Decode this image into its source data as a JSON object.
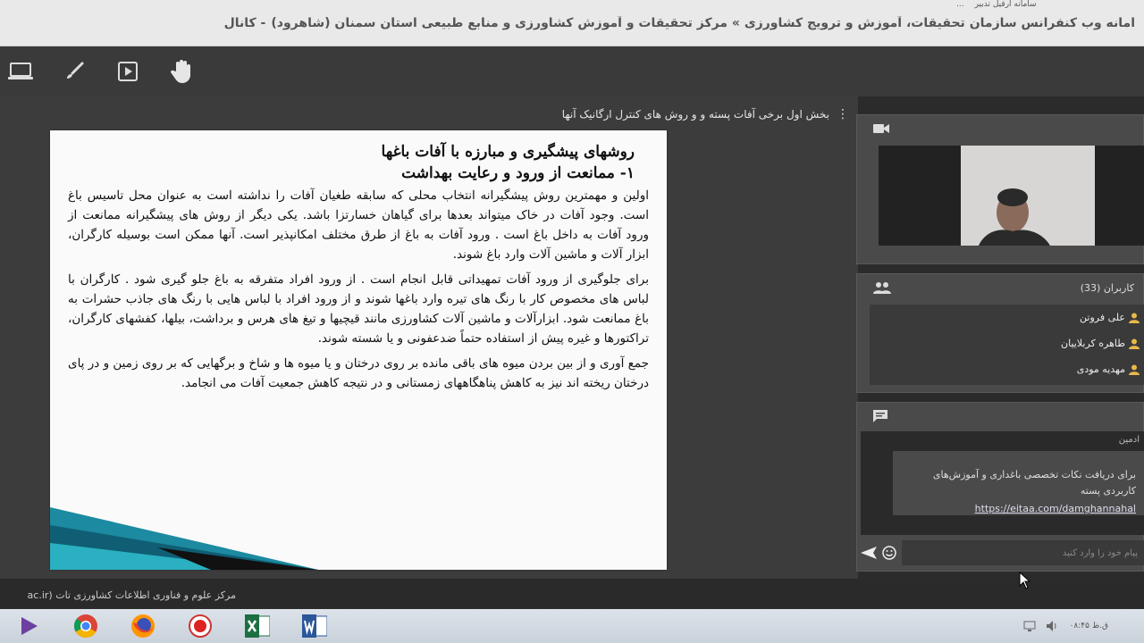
{
  "top_strip": {
    "user_name": "سامانه ارقیل تدبیر",
    "extra": "..."
  },
  "page_title": {
    "main": "امانه وب کنفرانس سازمان تحقیقات، آموزش و ترویج کشاورزی » مرکز تحقیقات و آموزش کشاورزی و منابع طبیعی استان سمنان (شاهرود)",
    "tail": "- کانال"
  },
  "toolbar": {
    "icons": [
      "screen-share-icon",
      "brush-icon",
      "play-media-icon",
      "hand-raise-icon"
    ]
  },
  "stage": {
    "title": "بخش اول برخی آفات پسته و و روش های کنترل ارگانیک آنها"
  },
  "slide": {
    "heading": "روشهای پیشگیری و مبارزه با آفات باغها",
    "subheading": "۱- ممانعت از ورود و رعایت بهداشت",
    "paragraphs": [
      "اولین و مهمترین روش پیشگیرانه انتخاب محلی که سابقه طغیان آفات را نداشته است به عنوان محل تاسیس باغ است. وجود آفات در خاک میتواند بعدها برای گیاهان خسارتزا باشد. یکی دیگر از روش های پیشگیرانه ممانعت از ورود آفات به داخل باغ است . ورود آفات به باغ از طرق مختلف امکانپذیر است. آنها ممکن است بوسیله کارگران، ابزار آلات و ماشین آلات وارد باغ شوند.",
      "برای جلوگیری از ورود آفات تمهیداتی قابل انجام است . از ورود افراد متفرقه به باغ جلو گیری شود . کارگران با لباس های مخصوص کار با رنگ های تیره وارد باغها شوند و از ورود افراد با لباس هایی با رنگ های جاذب حشرات به باغ ممانعت شود. ابزارآلات و ماشین آلات کشاورزی مانند قیچیها و تیغ های هرس و برداشت، بیلها، کفشهای کارگران، تراکتورها و غیره پیش از استفاده حتماً ضدعفونی و یا شسته شوند.",
      "جمع آوری و از بین بردن میوه های باقی مانده بر روی درختان و یا میوه ها و شاخ و برگهایی که بر روی زمین و در پای درختان ریخته اند نیز به کاهش پناهگاههای زمستانی و در نتیجه کاهش جمعیت آفات می انجامد."
    ]
  },
  "users_panel": {
    "title": "کاربران (33)",
    "users": [
      "علی فروتن",
      "طاهره کربلاییان",
      "مهدیه مودی"
    ]
  },
  "chat_panel": {
    "sender": "ادمین",
    "message": "برای دریافت نکات تخصصی باغداری و آموزش‌های کاربردی پسته",
    "link": "https://eitaa.com/damghannahal",
    "input_placeholder": "پیام خود را وارد کنید"
  },
  "footer": {
    "text": "مرکز علوم و فناوری اطلاعات کشاورزی تات (ac.ir"
  },
  "taskbar": {
    "apps": [
      "media-player-icon",
      "chrome-icon",
      "firefox-icon",
      "record-icon",
      "excel-icon",
      "word-icon"
    ],
    "clock": "۰۸:۴۵ ق.ظ"
  },
  "colors": {
    "accent_yellow": "#e8b84a",
    "panel_bg": "#4a4a4a",
    "stage_bg": "#3c3c3c"
  }
}
